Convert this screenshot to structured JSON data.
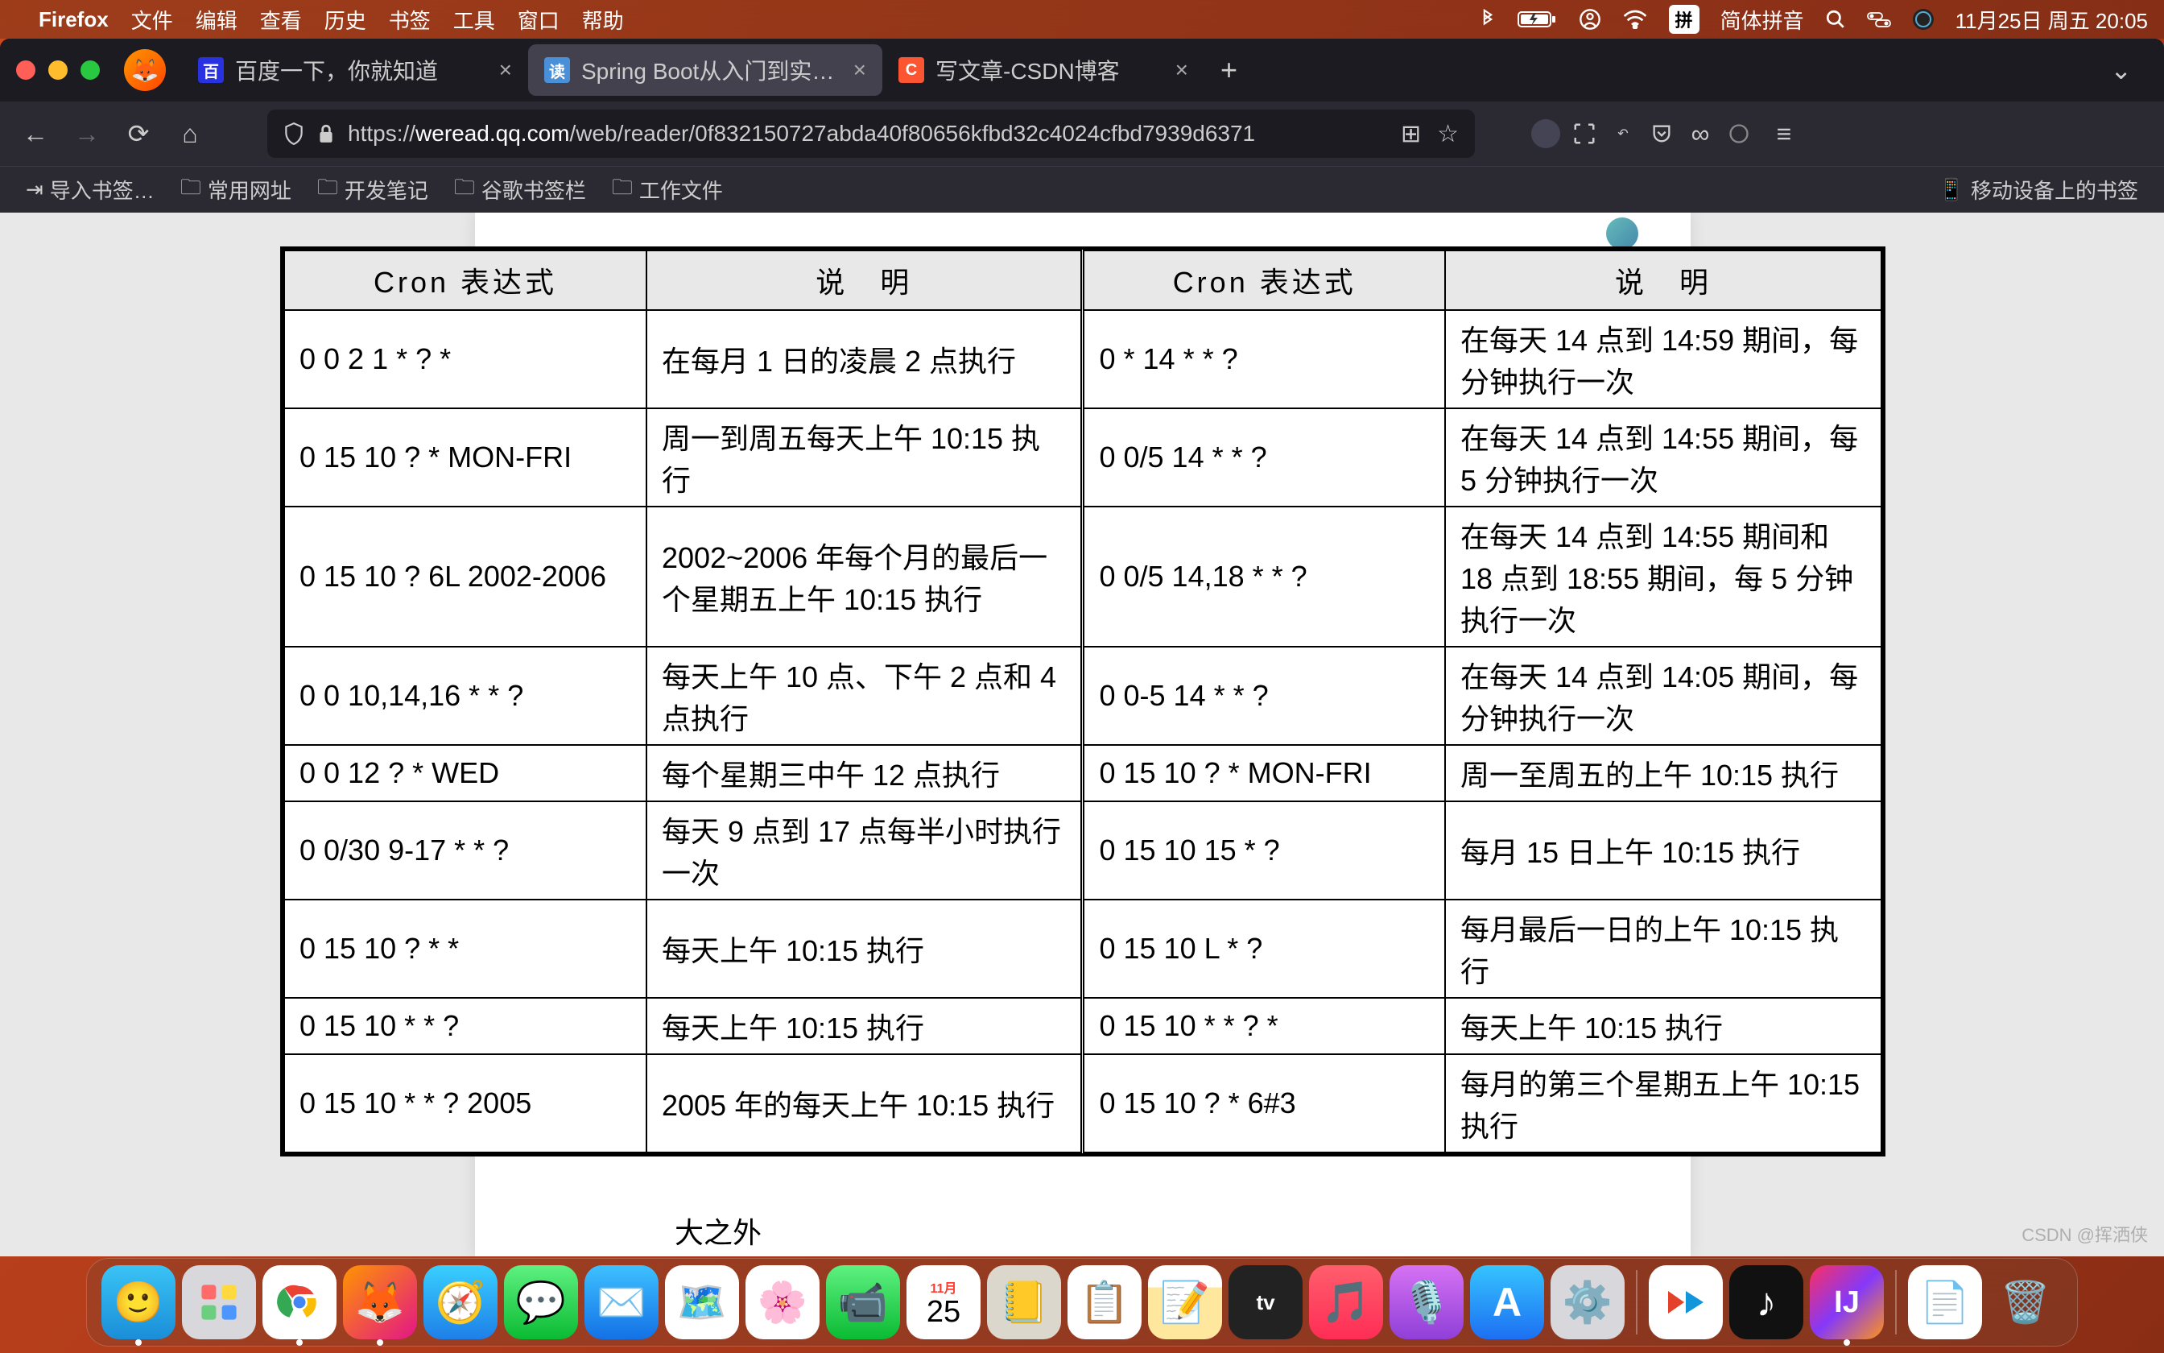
{
  "menubar": {
    "app": "Firefox",
    "items": [
      "文件",
      "编辑",
      "查看",
      "历史",
      "书签",
      "工具",
      "窗口",
      "帮助"
    ],
    "ime_short": "拼",
    "ime_label": "简体拼音",
    "datetime": "11月25日 周五  20:05"
  },
  "tabs": {
    "t1": {
      "title": "百度一下，你就知道"
    },
    "t2": {
      "title": "Spring Boot从入门到实战-章为忠"
    },
    "t3": {
      "title": "写文章-CSDN博客"
    }
  },
  "url": {
    "scheme": "https://",
    "host": "weread.qq.com",
    "path": "/web/reader/0f832150727abda40f80656kfbd32c4024cfbd7939d6371"
  },
  "bookmarks": {
    "b1": "导入书签…",
    "b2": "常用网址",
    "b3": "开发笔记",
    "b4": "谷歌书签栏",
    "b5": "工作文件",
    "mobile": "移动设备上的书签"
  },
  "table": {
    "h_expr": "Cron 表达式",
    "h_desc": "说　明",
    "left": [
      {
        "e": "0 0 2 1 * ? *",
        "d": "在每月 1 日的凌晨 2 点执行"
      },
      {
        "e": "0 15 10 ? * MON-FRI",
        "d": "周一到周五每天上午 10:15 执行"
      },
      {
        "e": "0 15 10 ? 6L 2002-2006",
        "d": "2002~2006 年每个月的最后一个星期五上午 10:15 执行"
      },
      {
        "e": "0 0 10,14,16 * * ?",
        "d": "每天上午 10 点、下午 2 点和 4 点执行"
      },
      {
        "e": "0 0 12 ? * WED",
        "d": "每个星期三中午 12 点执行"
      },
      {
        "e": "0 0/30 9-17 * * ?",
        "d": "每天 9 点到 17 点每半小时执行一次"
      },
      {
        "e": "0 15 10 ? * *",
        "d": "每天上午 10:15 执行"
      },
      {
        "e": "0 15 10 * * ?",
        "d": "每天上午 10:15 执行"
      },
      {
        "e": "0 15 10 * * ? 2005",
        "d": "2005 年的每天上午 10:15 执行"
      }
    ],
    "right": [
      {
        "e": "0 * 14 * * ?",
        "d": "在每天 14 点到 14:59 期间，每分钟执行一次"
      },
      {
        "e": "0 0/5 14 * * ?",
        "d": "在每天 14 点到 14:55 期间，每 5 分钟执行一次"
      },
      {
        "e": "0 0/5 14,18 * * ?",
        "d": "在每天 14 点到 14:55 期间和 18 点到 18:55 期间，每 5 分钟执行一次"
      },
      {
        "e": "0 0-5 14 * * ?",
        "d": "在每天 14 点到 14:05 期间，每分钟执行一次"
      },
      {
        "e": "0 15 10 ? * MON-FRI",
        "d": "周一至周五的上午 10:15 执行"
      },
      {
        "e": "0 15 10 15 * ?",
        "d": "每月 15 日上午 10:15 执行"
      },
      {
        "e": "0 15 10 L * ?",
        "d": "每月最后一日的上午 10:15 执行"
      },
      {
        "e": "0 15 10 * * ? *",
        "d": "每天上午 10:15 执行"
      },
      {
        "e": "0 15 10 ? * 6#3",
        "d": "每月的第三个星期五上午 10:15 执行"
      }
    ]
  },
  "bottom_text": "大之外",
  "watermark": "CSDN @挥洒侠"
}
